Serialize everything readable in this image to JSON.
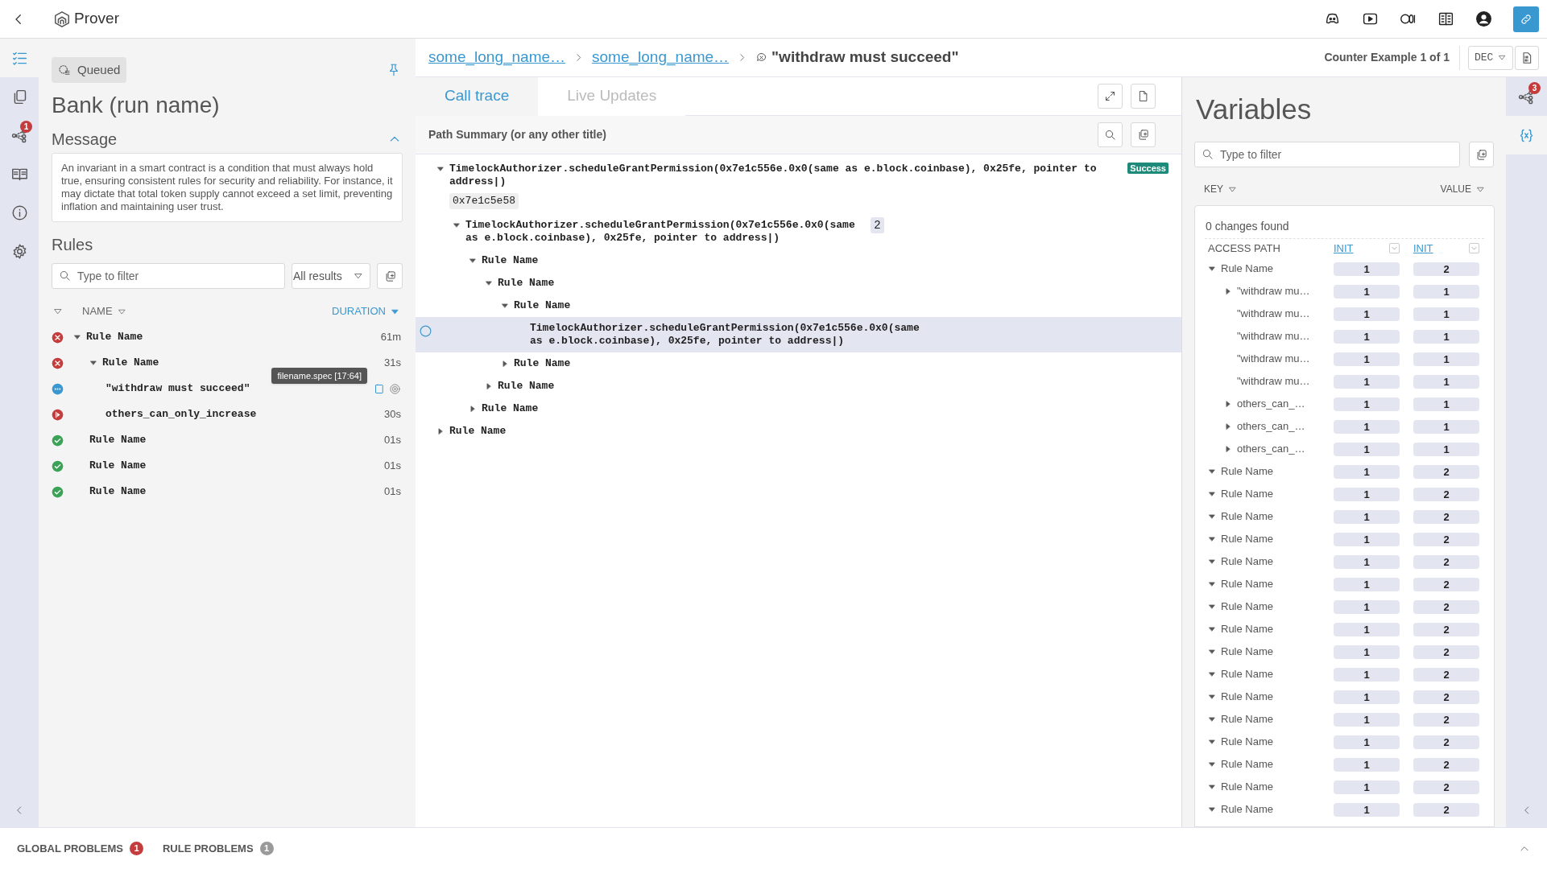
{
  "topbar": {
    "app_name": "Prover"
  },
  "left_rail": {
    "items": [
      {
        "kind": "list",
        "selected": true
      },
      {
        "kind": "copy",
        "selected": false
      },
      {
        "kind": "graph",
        "selected": false,
        "badge": "1"
      },
      {
        "kind": "book",
        "selected": false
      },
      {
        "kind": "info",
        "selected": false
      },
      {
        "kind": "settings",
        "selected": false
      }
    ]
  },
  "run": {
    "status": "Queued",
    "title": "Bank (run name)",
    "message_heading": "Message",
    "message_expanded": true,
    "message": "An invariant in a smart contract is a condition that must always hold true, ensuring consistent rules for security and reliability. For instance, it may dictate that total token supply cannot exceed a set limit, preventing inflation and maintaining user trust."
  },
  "rules": {
    "heading": "Rules",
    "filter": {
      "placeholder": "Type to filter"
    },
    "results_filter": "All results",
    "columns": [
      {
        "label": "NAME",
        "sorted": false
      },
      {
        "label": "DURATION",
        "sorted": true
      }
    ],
    "tooltip": "filename.spec [17:64]",
    "rows": [
      {
        "kind": "failed",
        "name": "Rule Name",
        "duration": "61m",
        "expanded": true,
        "children": [
          {
            "kind": "failed",
            "name": "Rule Name",
            "duration": "31s",
            "expanded": true,
            "children": [
              {
                "kind": "running",
                "name": "\"withdraw must succeed\"",
                "hovered": true
              },
              {
                "kind": "timeout",
                "name": "others_can_only_increase",
                "duration": "30s"
              }
            ]
          },
          {
            "kind": "passed",
            "name": "Rule Name",
            "duration": "01s"
          },
          {
            "kind": "passed",
            "name": "Rule Name",
            "duration": "01s"
          },
          {
            "kind": "passed",
            "name": "Rule Name",
            "duration": "01s"
          }
        ]
      }
    ]
  },
  "breadcrumb": {
    "links": [
      "some_long_name…",
      "some_long_name…"
    ],
    "current": "\"withdraw must succeed\""
  },
  "counter": "Counter Example 1 of 1",
  "number_format": "DEC",
  "trace": {
    "tabs": [
      {
        "label": "Call trace",
        "selected": true
      },
      {
        "label": "Live Updates",
        "selected": false
      }
    ],
    "title": "Path Summary (or any other title)",
    "nodes": [
      {
        "text": "TimelockAuthorizer.scheduleGrantPermission(0x7e1c556e.0x0(same as e.block.coinbase), 0x25fe, pointer to address|)",
        "expanded": true,
        "badge": "Success",
        "chip": "0x7e1c5e58",
        "children": [
          {
            "text": "TimelockAuthorizer.scheduleGrantPermission(0x7e1c556e.0x0(same as e.block.coinbase), 0x25fe, pointer to address|)",
            "count": "2",
            "expanded": true,
            "children": [
              {
                "text": "Rule Name",
                "expanded": true,
                "children": [
                  {
                    "text": "Rule Name",
                    "expanded": true,
                    "children": [
                      {
                        "text": "Rule Name",
                        "expanded": true,
                        "children": [
                          {
                            "text": "TimelockAuthorizer.scheduleGrantPermission(0x7e1c556e.0x0(same as e.block.coinbase), 0x25fe, pointer to address|)",
                            "selected": true
                          }
                        ]
                      },
                      {
                        "text": "Rule Name",
                        "expanded": false
                      }
                    ]
                  },
                  {
                    "text": "Rule Name",
                    "expanded": false
                  }
                ]
              },
              {
                "text": "Rule Name",
                "expanded": false
              }
            ]
          }
        ]
      },
      {
        "text": "Rule Name",
        "expanded": false
      }
    ]
  },
  "variables": {
    "title": "Variables",
    "filter": {
      "placeholder": "Type to filter"
    },
    "key_label": "KEY",
    "value_label": "VALUE",
    "summary": "0 changes found",
    "columns": [
      "ACCESS PATH",
      "INIT",
      "INIT"
    ],
    "rows": [
      {
        "name": "Rule Name",
        "values": [
          "1",
          "2"
        ],
        "expanded": true,
        "children": [
          {
            "name": "\"withdraw mu…",
            "values": [
              "1",
              "1"
            ],
            "expanded": false
          },
          {
            "name": "\"withdraw mu…",
            "values": [
              "1",
              "1"
            ]
          },
          {
            "name": "\"withdraw mu…",
            "values": [
              "1",
              "1"
            ]
          },
          {
            "name": "\"withdraw mu…",
            "values": [
              "1",
              "1"
            ]
          },
          {
            "name": "\"withdraw mu…",
            "values": [
              "1",
              "1"
            ]
          },
          {
            "name": "others_can_…",
            "values": [
              "1",
              "1"
            ],
            "expanded": false
          },
          {
            "name": "others_can_…",
            "values": [
              "1",
              "1"
            ],
            "expanded": false
          },
          {
            "name": "others_can_…",
            "values": [
              "1",
              "1"
            ],
            "expanded": false
          }
        ]
      },
      {
        "name": "Rule Name",
        "values": [
          "1",
          "2"
        ],
        "expanded": true
      },
      {
        "name": "Rule Name",
        "values": [
          "1",
          "2"
        ],
        "expanded": true
      },
      {
        "name": "Rule Name",
        "values": [
          "1",
          "2"
        ],
        "expanded": true
      },
      {
        "name": "Rule Name",
        "values": [
          "1",
          "2"
        ],
        "expanded": true
      },
      {
        "name": "Rule Name",
        "values": [
          "1",
          "2"
        ],
        "expanded": true
      },
      {
        "name": "Rule Name",
        "values": [
          "1",
          "2"
        ],
        "expanded": true
      },
      {
        "name": "Rule Name",
        "values": [
          "1",
          "2"
        ],
        "expanded": true
      },
      {
        "name": "Rule Name",
        "values": [
          "1",
          "2"
        ],
        "expanded": true
      },
      {
        "name": "Rule Name",
        "values": [
          "1",
          "2"
        ],
        "expanded": true
      },
      {
        "name": "Rule Name",
        "values": [
          "1",
          "2"
        ],
        "expanded": true
      },
      {
        "name": "Rule Name",
        "values": [
          "1",
          "2"
        ],
        "expanded": true
      },
      {
        "name": "Rule Name",
        "values": [
          "1",
          "2"
        ],
        "expanded": true
      },
      {
        "name": "Rule Name",
        "values": [
          "1",
          "2"
        ],
        "expanded": true
      },
      {
        "name": "Rule Name",
        "values": [
          "1",
          "2"
        ],
        "expanded": true
      },
      {
        "name": "Rule Name",
        "values": [
          "1",
          "2"
        ],
        "expanded": true
      },
      {
        "name": "Rule Name",
        "values": [
          "1",
          "2"
        ],
        "expanded": true
      }
    ]
  },
  "right_rail": {
    "items": [
      {
        "kind": "graph",
        "selected": false,
        "badge": "3"
      },
      {
        "kind": "variables",
        "selected": true
      }
    ]
  },
  "bottom_bar": {
    "tabs": [
      {
        "label": "GLOBAL PROBLEMS",
        "count": "1",
        "color": "#c43c3c"
      },
      {
        "label": "RULE PROBLEMS",
        "count": "1",
        "color": "#9a9a9a"
      }
    ]
  }
}
